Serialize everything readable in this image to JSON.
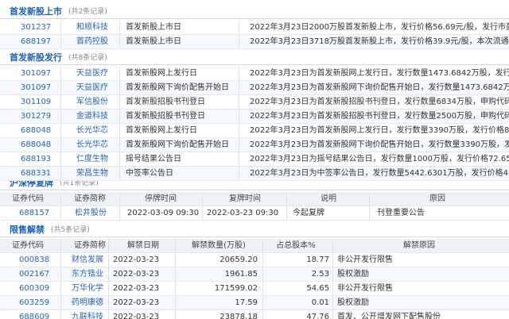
{
  "listing": {
    "title": "首发新股上市",
    "count": "(共2条记录)",
    "rows": [
      {
        "code": "301237",
        "name": "和顺科技",
        "type": "首发新股上市日",
        "desc": "2022年3月23日2000万股首发新股上市，发行价格56.69元/股，发行市盈率"
      },
      {
        "code": "688197",
        "name": "首药控股",
        "type": "首发新股上市日",
        "desc": "2022年3月23日3718万股首发新股上市，发行价格39.9元/股，本次流通数"
      }
    ]
  },
  "issuance": {
    "title": "首发新股发行",
    "count": "(共8条记录)",
    "rows": [
      {
        "code": "301097",
        "name": "天益医疗",
        "type": "首发新股网上发行日",
        "desc": "2022年3月23日为首发新股网上发行日，发行数量1473.6842万股，发行价格"
      },
      {
        "code": "301097",
        "name": "天益医疗",
        "type": "首发新股网下询价配售开始日",
        "desc": "2022年3月23日为首发新股网下询价配售开始日，发行数量1473.6842万股，发"
      },
      {
        "code": "301109",
        "name": "军信股份",
        "type": "首发新股招股书刊登日",
        "desc": "2022年3月23日为首发新股招股书刊登日，发行数量6834万股，申购代码3"
      },
      {
        "code": "301279",
        "name": "金道科技",
        "type": "首发新股招股书刊登日",
        "desc": "2022年3月23日为首发新股招股书刊登日，发行数量2500万股，申购代码3"
      },
      {
        "code": "688048",
        "name": "长光华芯",
        "type": "首发新股网上发行日",
        "desc": "2022年3月23日为首发新股网上发行日，发行数量3390万股，发行价格80.8"
      },
      {
        "code": "688048",
        "name": "长光华芯",
        "type": "首发新股网下询价配售开始日",
        "desc": "2022年3月23日为首发新股网下询价配售开始日，发行数量3390万股，发行价"
      },
      {
        "code": "688193",
        "name": "仁度生物",
        "type": "摇号结果公告日",
        "desc": "2022年3月23日为摇号结果公告日，发行数量1000万股，发行价格72.65元/"
      },
      {
        "code": "688331",
        "name": "荣昌生物",
        "type": "中签率公告日",
        "desc": "2022年3月23日为中签率公告日，发行数量5442.6301万股，发行价格48元/"
      }
    ]
  },
  "suspension": {
    "title": "沪深停复牌",
    "count": "(共1条记录)",
    "headers": [
      "证券代码",
      "证券简称",
      "停牌时间",
      "复牌时间",
      "说明",
      "原因"
    ],
    "rows": [
      {
        "code": "688157",
        "name": "松井股份",
        "stop": "2022-03-09 09:30",
        "resume": "2022-03-23 09:30",
        "note": "今起复牌",
        "reason": "刊登重要公告"
      }
    ]
  },
  "unlock": {
    "title": "限售解禁",
    "count": "(共5条记录)",
    "headers": [
      "证券代码",
      "证券简称",
      "解禁日期",
      "解禁数量(万股)",
      "占总股本%",
      "解禁原因"
    ],
    "rows": [
      {
        "code": "000838",
        "name": "财信发展",
        "date": "2022-03-23",
        "qty": "20659.20",
        "pct": "18.77",
        "reason": "非公开发行限售"
      },
      {
        "code": "002167",
        "name": "东方锆业",
        "date": "2022-03-23",
        "qty": "1961.85",
        "pct": "2.53",
        "reason": "股权激励"
      },
      {
        "code": "600309",
        "name": "万华化学",
        "date": "2022-03-23",
        "qty": "171599.02",
        "pct": "54.65",
        "reason": "非公开发行限售"
      },
      {
        "code": "603259",
        "name": "药明康德",
        "date": "2022-03-23",
        "qty": "17.59",
        "pct": "0.01",
        "reason": "股权激励"
      },
      {
        "code": "688609",
        "name": "九联科技",
        "date": "2022-03-23",
        "qty": "23878.18",
        "pct": "47.76",
        "reason": "首发、公开增发网下配售股份"
      }
    ]
  }
}
